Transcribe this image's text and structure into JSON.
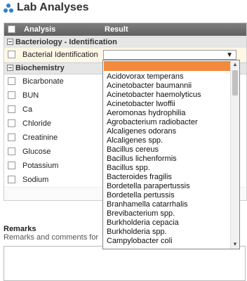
{
  "page": {
    "title": "Lab Analyses"
  },
  "table": {
    "headers": {
      "analysis": "Analysis",
      "result": "Result"
    },
    "groups": [
      {
        "name": "Bacteriology - Identification",
        "rows": [
          {
            "name": "Bacterial Identification"
          }
        ]
      },
      {
        "name": "Biochemistry",
        "rows": [
          {
            "name": "Bicarbonate"
          },
          {
            "name": "BUN"
          },
          {
            "name": "Ca"
          },
          {
            "name": "Chloride"
          },
          {
            "name": "Creatinine"
          },
          {
            "name": "Glucose"
          },
          {
            "name": "Potassium"
          },
          {
            "name": "Sodium"
          }
        ]
      }
    ]
  },
  "remarks": {
    "title": "Remarks",
    "subtitle": "Remarks and comments for"
  },
  "dropdown": {
    "options": [
      "Acidovorax temperans",
      "Acinetobacter baumannii",
      "Acinetobacter haemolyticus",
      "Acinetobacter lwoffii",
      "Aeromonas hydrophilia",
      "Agrobacterium radiobacter",
      "Alcaligenes odorans",
      "Alcaligenes spp.",
      "Bacillus cereus",
      "Bacillus lichenformis",
      "Bacillus spp.",
      "Bacteroides fragilis",
      "Bordetella parapertussis",
      "Bordetella pertussis",
      "Branhamella catarrhalis",
      "Brevibacterium spp.",
      "Burkholderia cepacia",
      "Burkholderia spp.",
      "Campylobacter coli"
    ]
  },
  "colors": {
    "dropdown_highlight": "#f28a3d",
    "header_gradient_top": "#7f7f7f",
    "header_gradient_bottom": "#5f5f5f"
  },
  "icons": {
    "logo": "dots-logo-icon",
    "select_arrow": "triangle-down-icon",
    "group_toggle": "minus-box-icon",
    "checkbox": "checkbox-icon"
  }
}
